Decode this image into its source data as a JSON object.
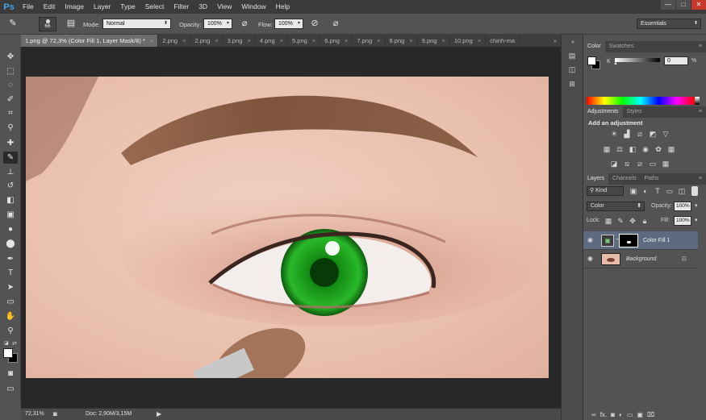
{
  "app": {
    "logo": "Ps",
    "menu": [
      "File",
      "Edit",
      "Image",
      "Layer",
      "Type",
      "Select",
      "Filter",
      "3D",
      "View",
      "Window",
      "Help"
    ],
    "window_controls": [
      "—",
      "□",
      "✕"
    ]
  },
  "options_bar": {
    "brush_size": "66",
    "mode_label": "Mode:",
    "mode_value": "Normal",
    "opacity_label": "Opacity:",
    "opacity_value": "100%",
    "flow_label": "Flow:",
    "flow_value": "100%",
    "workspace": "Essentials"
  },
  "tabs": [
    {
      "label": "1.png @ 72,3% (Color Fill 1, Layer Mask/8) *",
      "active": true
    },
    {
      "label": "2.png"
    },
    {
      "label": "2.png"
    },
    {
      "label": "3.png"
    },
    {
      "label": "4.png"
    },
    {
      "label": "5.png"
    },
    {
      "label": "6.png"
    },
    {
      "label": "7.png"
    },
    {
      "label": "8.png"
    },
    {
      "label": "9.png"
    },
    {
      "label": "10.png"
    },
    {
      "label": "chinh-ma"
    }
  ],
  "tab_overflow": "»",
  "status": {
    "zoom": "72,31%",
    "doc": "Doc: 2,90M/3,15M"
  },
  "color_panel": {
    "tabs": [
      "Color",
      "Swatches"
    ],
    "channel": "K",
    "value": "0",
    "unit": "%"
  },
  "adjustments_panel": {
    "tabs": [
      "Adjustments",
      "Styles"
    ],
    "heading": "Add an adjustment"
  },
  "layers_panel": {
    "tabs": [
      "Layers",
      "Channels",
      "Paths"
    ],
    "filter_kind": "Kind",
    "blend_mode": "Color",
    "opacity_label": "Opacity:",
    "opacity_value": "100%",
    "lock_label": "Lock:",
    "fill_label": "Fill:",
    "fill_value": "100%",
    "layers": [
      {
        "name": "Color Fill 1",
        "selected": true,
        "visible": true
      },
      {
        "name": "Background",
        "selected": false,
        "visible": true,
        "locked": true
      }
    ],
    "footer_fx": "fx."
  },
  "colors": {
    "accent_blue": "#4aa3e8",
    "eye_green": "#1fa81f",
    "selected_layer": "#5c6b80"
  }
}
